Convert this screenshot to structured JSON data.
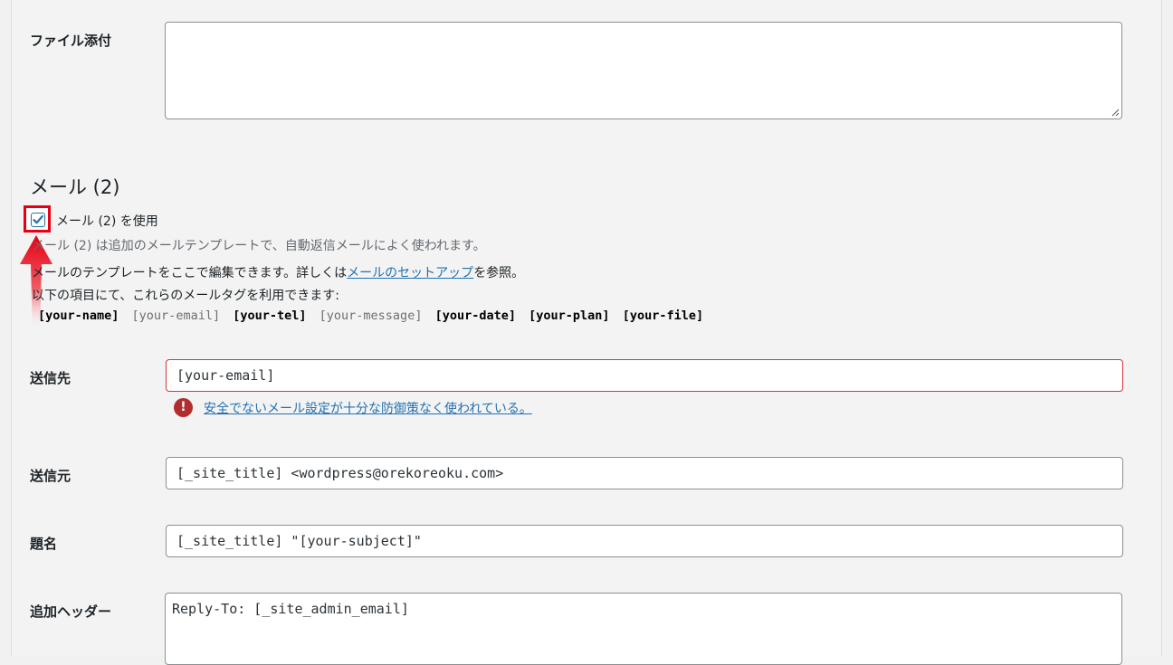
{
  "attachments": {
    "label": "ファイル添付",
    "value": ""
  },
  "mail2": {
    "heading": "メール (2)",
    "checkbox_label": "メール (2) を使用",
    "checked": true,
    "description": "メール (2) は追加のメールテンプレートで、自動返信メールによく使われます。",
    "help_prefix": "メールのテンプレートをここで編集できます。詳しくは",
    "help_link": "メールのセットアップ",
    "help_suffix": "を参照。",
    "tags_intro": "以下の項目にて、これらのメールタグを利用できます:",
    "mail_tags": [
      {
        "text": "[your-name]",
        "required": true
      },
      {
        "text": "[your-email]",
        "required": false
      },
      {
        "text": "[your-tel]",
        "required": true
      },
      {
        "text": "[your-message]",
        "required": false
      },
      {
        "text": "[your-date]",
        "required": true
      },
      {
        "text": "[your-plan]",
        "required": true
      },
      {
        "text": "[your-file]",
        "required": true
      }
    ]
  },
  "fields": {
    "to": {
      "label": "送信先",
      "value": "[your-email]"
    },
    "warning": {
      "icon": "!",
      "text": "安全でないメール設定が十分な防御策なく使われている。"
    },
    "from": {
      "label": "送信元",
      "value": "[_site_title] <wordpress@orekoreoku.com>"
    },
    "subject": {
      "label": "題名",
      "value": "[_site_title] \"[your-subject]\""
    },
    "headers": {
      "label": "追加ヘッダー",
      "value": "Reply-To: [_site_admin_email]"
    }
  },
  "colors": {
    "accent": "#2271b1",
    "error": "#d63638",
    "highlight": "#e60012"
  }
}
